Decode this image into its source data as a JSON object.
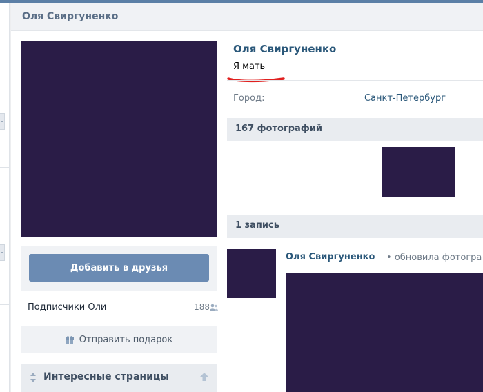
{
  "header": {
    "title": "Оля Свиргуненко"
  },
  "profile": {
    "name": "Оля Свиргуненко",
    "status": "Я мать",
    "info": {
      "city_label": "Город:",
      "city_value": "Санкт-Петербург"
    }
  },
  "left_column": {
    "add_friend_label": "Добавить в друзья",
    "subscribers_label": "Подписчики Оли",
    "subscribers_count": "188",
    "gift_label": "Отправить подарок",
    "interesting_label": "Интересные страницы"
  },
  "photos": {
    "title": "167 фотографий"
  },
  "wall": {
    "title": "1 запись",
    "post": {
      "author": "Оля Свиргуненко",
      "action": "обновила фотогра"
    }
  },
  "colors": {
    "placeholder": "#2a1c47",
    "link": "#2b587a",
    "button": "#6b8bb3",
    "annotation": "#e0201f"
  },
  "icons": {
    "people": "people-icon",
    "gift": "gift-icon",
    "sort": "sort-arrows-icon",
    "collapse": "arrow-up-icon"
  }
}
